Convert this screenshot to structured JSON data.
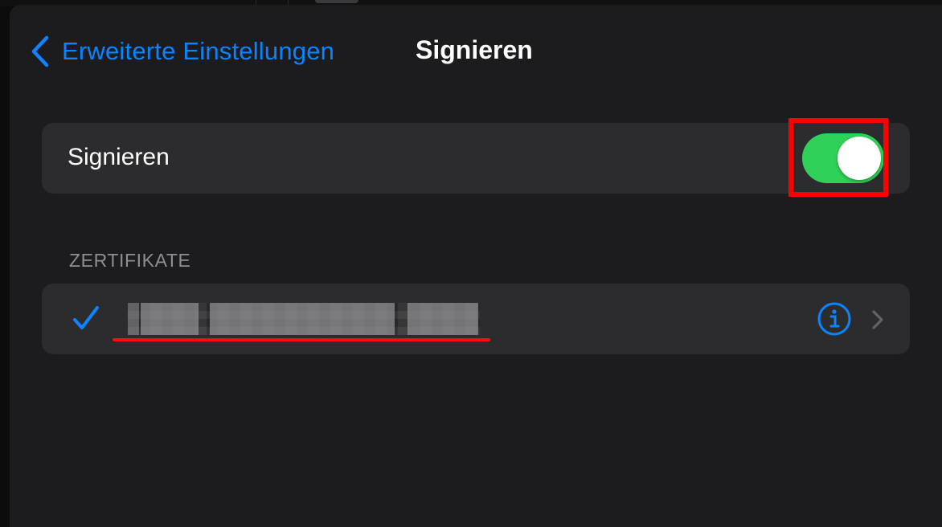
{
  "navbar": {
    "back_label": "Erweiterte Einstellungen",
    "title": "Signieren"
  },
  "signing": {
    "label": "Signieren",
    "enabled": true,
    "toggle_color": "#30d158"
  },
  "certificates": {
    "header": "ZERTIFIKATE",
    "items": [
      {
        "name_redacted": true,
        "selected": true,
        "icons": [
          "checkmark-icon",
          "info-icon",
          "chevron-right-icon"
        ]
      }
    ]
  },
  "colors": {
    "accent": "#0a84ff",
    "background": "#1c1c1e",
    "group_background": "#2c2c2e",
    "annotation": "#ff0000"
  }
}
